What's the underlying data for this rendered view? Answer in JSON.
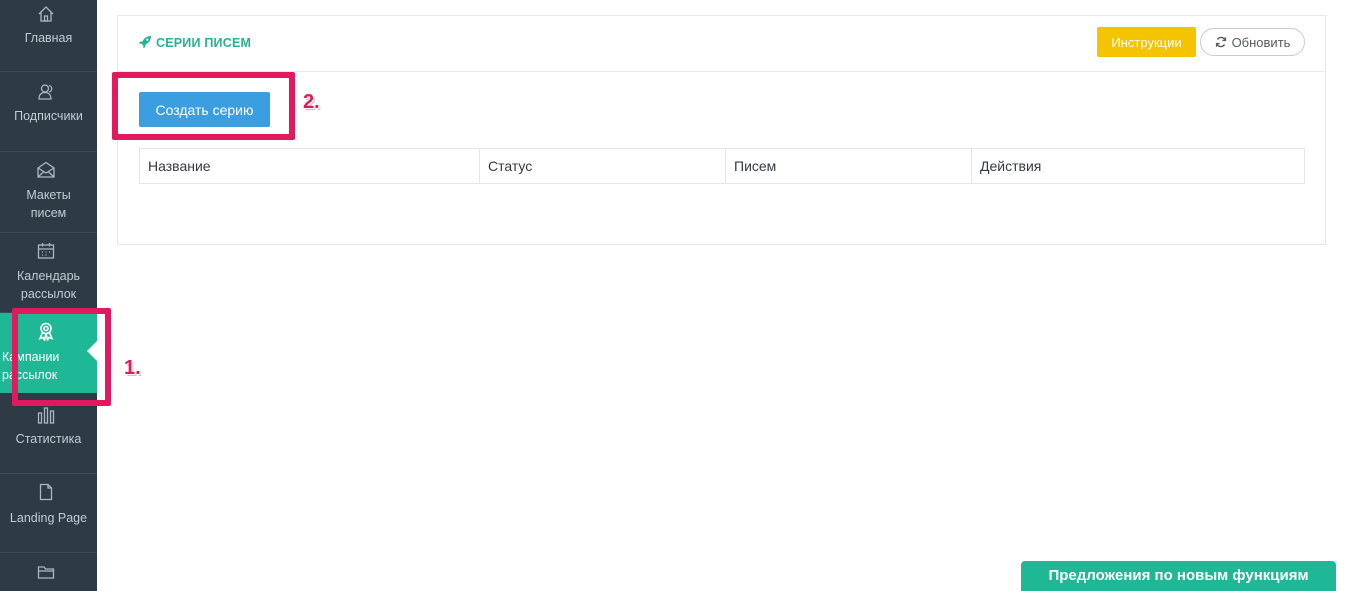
{
  "sidebar": {
    "items": [
      {
        "label": "Главная",
        "icon": "home-icon"
      },
      {
        "label": "Подписчики",
        "icon": "users-icon"
      },
      {
        "label": "Макеты\nписем",
        "icon": "envelope-icon"
      },
      {
        "label": "Календарь\nрассылок",
        "icon": "calendar-icon"
      },
      {
        "label": "Кампании\nрассылок",
        "icon": "award-icon",
        "active": true
      },
      {
        "label": "Статистика",
        "icon": "bar-chart-icon"
      },
      {
        "label": "Landing Page",
        "icon": "file-icon"
      },
      {
        "label": "",
        "icon": "folder-icon"
      }
    ]
  },
  "panel": {
    "title": "СЕРИИ ПИСЕМ",
    "title_icon": "rocket-icon",
    "instructions_label": "Инструкции",
    "refresh_label": "Обновить",
    "create_label": "Создать серию"
  },
  "table": {
    "columns": [
      "Название",
      "Статус",
      "Писем",
      "Действия"
    ]
  },
  "annotations": {
    "marker_1": "1.",
    "marker_2": "2."
  },
  "feedback": {
    "label": "Предложения по новым функциям"
  },
  "colors": {
    "sidebar_bg": "#2e3a46",
    "accent_green": "#1eb896",
    "primary_blue": "#3a9ee0",
    "warning_yellow": "#f5c400",
    "highlight_pink": "#e3195e"
  }
}
